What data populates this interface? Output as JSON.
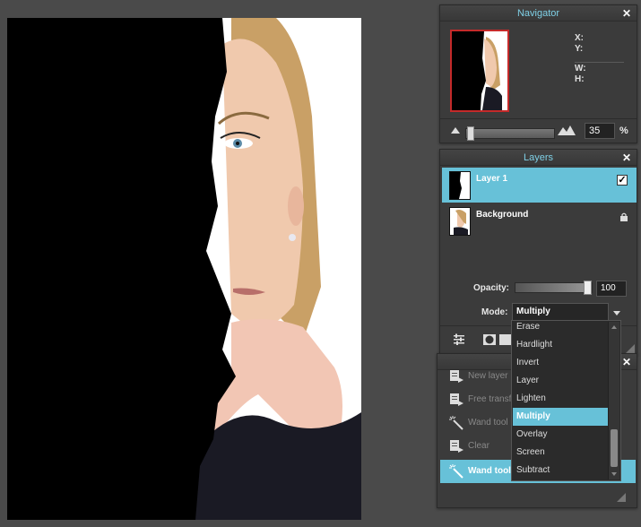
{
  "navigator": {
    "title": "Navigator",
    "x_label": "X:",
    "y_label": "Y:",
    "w_label": "W:",
    "h_label": "H:",
    "zoom_value": "35",
    "zoom_unit": "%"
  },
  "layers": {
    "title": "Layers",
    "items": [
      {
        "name": "Layer 1",
        "checked": "✓"
      },
      {
        "name": "Background"
      }
    ],
    "opacity_label": "Opacity:",
    "opacity_value": "100",
    "mode_label": "Mode:",
    "mode_value": "Multiply"
  },
  "history": {
    "items": [
      {
        "label": "New layer"
      },
      {
        "label": "Free transform"
      },
      {
        "label": "Wand tool"
      },
      {
        "label": "Clear"
      },
      {
        "label": "Wand tool"
      }
    ]
  },
  "blend_modes": {
    "options": [
      "Erase",
      "Hardlight",
      "Invert",
      "Layer",
      "Lighten",
      "Multiply",
      "Overlay",
      "Screen",
      "Subtract"
    ],
    "selected": "Multiply"
  },
  "colors": {
    "accent": "#67c1d8",
    "title_text": "#7fd0e6",
    "workspace": "#4a4a4a",
    "panel": "#3b3b3b",
    "navigator_frame": "#c42a2a"
  },
  "icons": {
    "close": "close-icon",
    "zoom_out": "mountain-small-icon",
    "zoom_in": "mountain-large-icon",
    "lock": "lock-icon",
    "adjust": "sliders-icon",
    "mask": "circle-mask-icon",
    "history_item": "document-arrow-icon",
    "wand": "magic-wand-icon"
  }
}
